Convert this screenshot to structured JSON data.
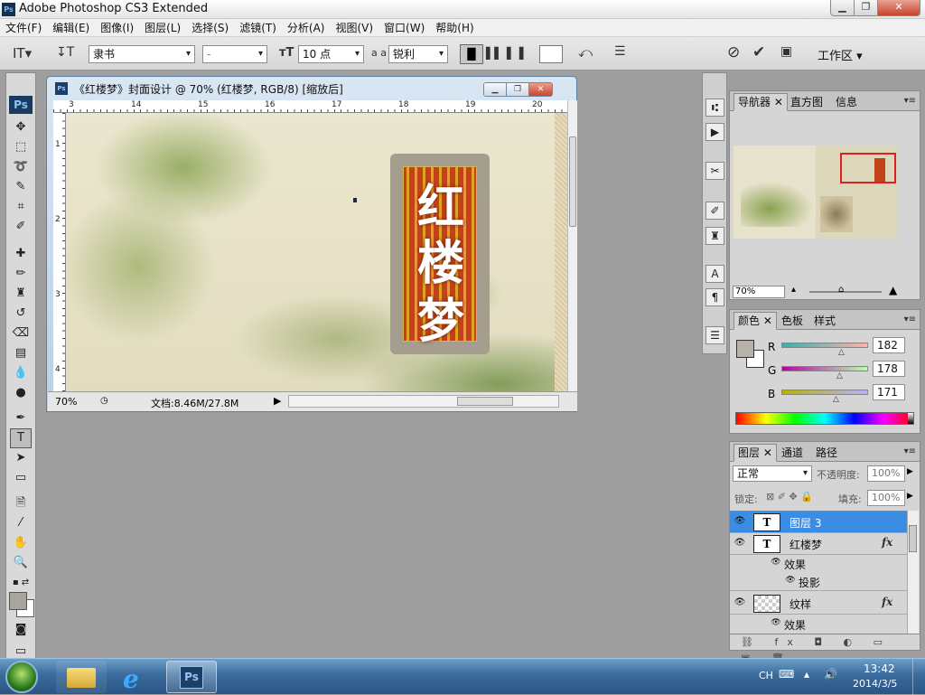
{
  "window": {
    "title": "Adobe Photoshop CS3 Extended",
    "app_icon": "Ps"
  },
  "menubar": [
    "文件(F)",
    "编辑(E)",
    "图像(I)",
    "图层(L)",
    "选择(S)",
    "滤镜(T)",
    "分析(A)",
    "视图(V)",
    "窗口(W)",
    "帮助(H)"
  ],
  "options": {
    "font_family": "隶书",
    "font_style": "-",
    "font_size": "10 点",
    "aa_label": "a a",
    "antialias": "锐利",
    "workspace": "工作区"
  },
  "document": {
    "title": "《红楼梦》封面设计 @ 70% (红楼梦, RGB/8) [缩放后]",
    "ruler_top": [
      "3",
      "14",
      "15",
      "16",
      "17",
      "18",
      "19",
      "20"
    ],
    "ruler_left": [
      "1",
      "2",
      "3",
      "4"
    ],
    "canvas_text": [
      "红",
      "楼",
      "梦"
    ],
    "zoom": "70%",
    "doc_size": "文档:8.46M/27.8M"
  },
  "navigator": {
    "tabs": [
      "导航器",
      "直方图",
      "信息"
    ],
    "zoom": "70%"
  },
  "color_panel": {
    "tabs": [
      "颜色",
      "色板",
      "样式"
    ],
    "r_label": "R",
    "g_label": "G",
    "b_label": "B",
    "r": "182",
    "g": "178",
    "b": "171",
    "swatch": "#b6b2ab"
  },
  "layers": {
    "tabs": [
      "图层",
      "通道",
      "路径"
    ],
    "blend_mode": "正常",
    "opacity_label": "不透明度:",
    "opacity": "100%",
    "lock_label": "锁定:",
    "fill_label": "填充:",
    "fill": "100%",
    "items": [
      {
        "name": "图层 3",
        "thumb": "T",
        "selected": true
      },
      {
        "name": "红楼梦",
        "thumb": "T",
        "fx": "fx"
      },
      {
        "name": "效果",
        "sub": true
      },
      {
        "name": "投影",
        "sub2": true
      },
      {
        "name": "纹样",
        "fx": "fx"
      },
      {
        "name": "效果",
        "sub": true
      }
    ]
  },
  "taskbar": {
    "ime": "CH",
    "time": "13:42",
    "date": "2014/3/5",
    "ps_label": "Ps"
  }
}
